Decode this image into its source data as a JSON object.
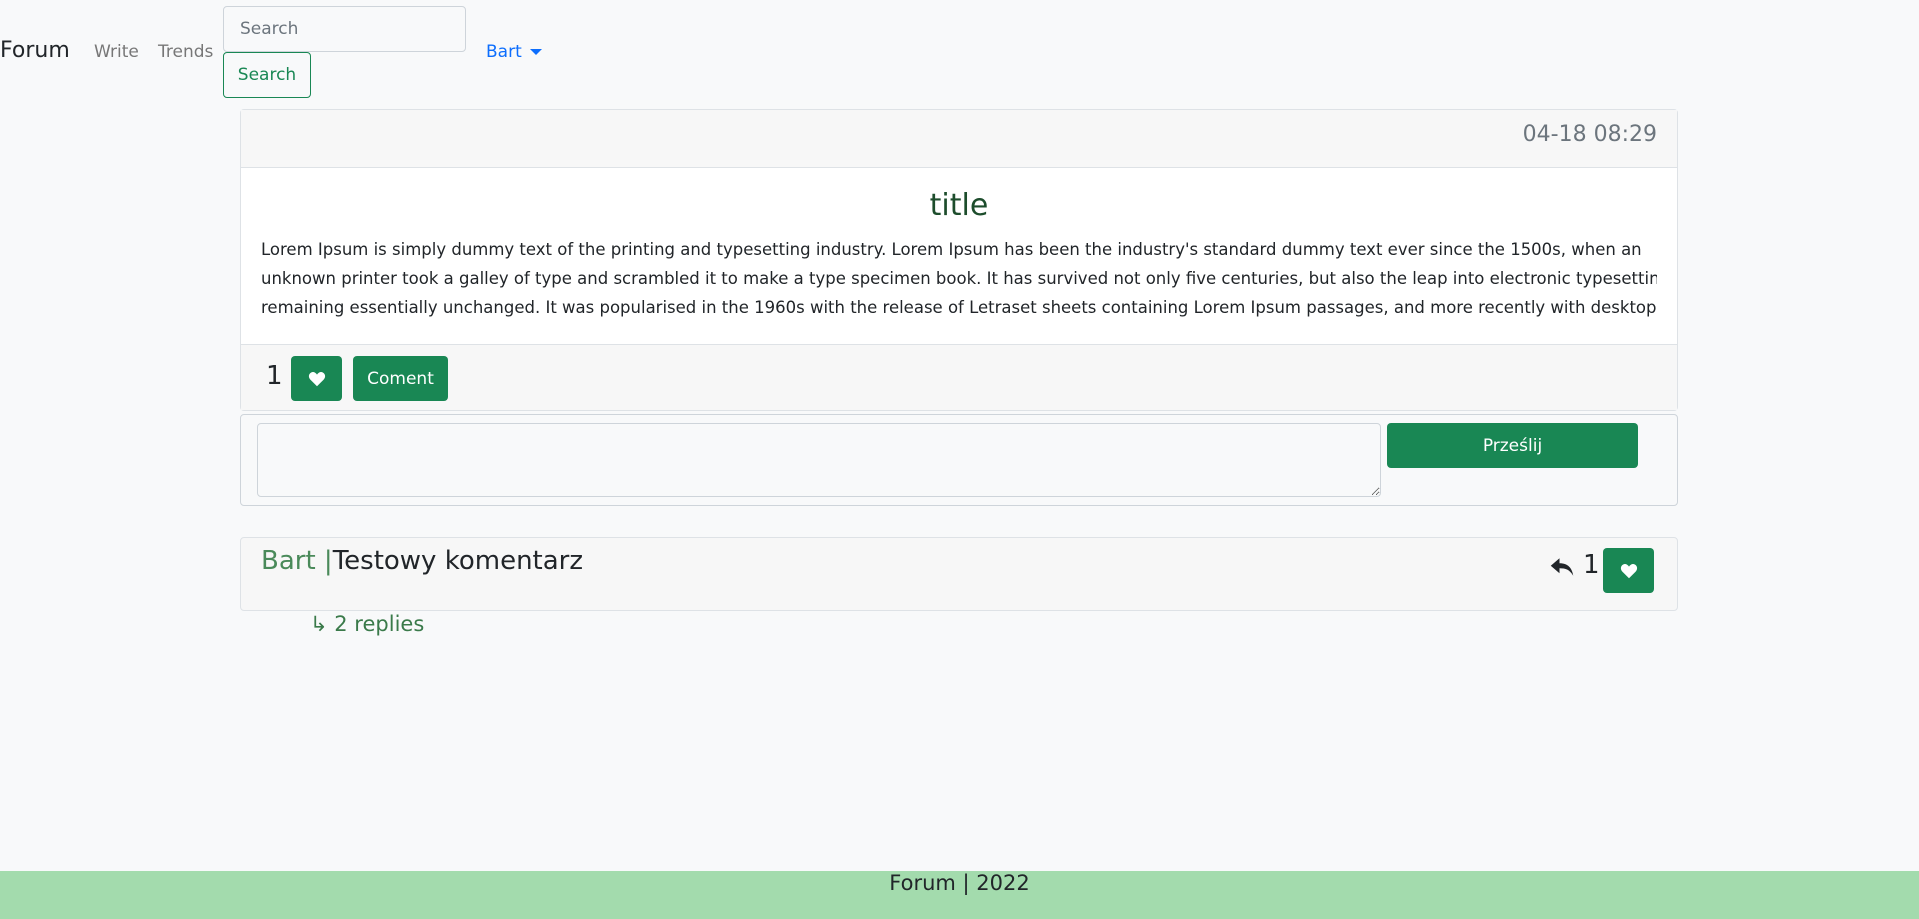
{
  "nav": {
    "brand": "Forum",
    "links": [
      "Write",
      "Trends"
    ],
    "search_placeholder": "Search",
    "search_button": "Search",
    "user": "Bart"
  },
  "post": {
    "timestamp": "04-18 08:29",
    "title": "title",
    "body_lines": [
      "Lorem Ipsum is simply dummy text of the printing and typesetting industry. Lorem Ipsum has been the industry's standard dummy text ever since the 1500s, when an",
      "unknown printer took a galley of type and scrambled it to make a type specimen book. It has survived not only five centuries, but also the leap into electronic typesetting,",
      "remaining essentially unchanged. It was popularised in the 1960s with the release of Letraset sheets containing Lorem Ipsum passages, and more recently with desktop p"
    ],
    "like_count": "1",
    "comment_button": "Coment"
  },
  "comment_form": {
    "submit_label": "Prześlij"
  },
  "comment": {
    "author": "Bart",
    "separator": " |",
    "text": "Testowy komentarz",
    "like_count": "1",
    "replies": "↳ 2 replies"
  },
  "footer": {
    "text": "Forum | 2022"
  },
  "colors": {
    "accent": "#198754",
    "footer_bg": "#a3dbad",
    "link": "#0d6efd"
  }
}
